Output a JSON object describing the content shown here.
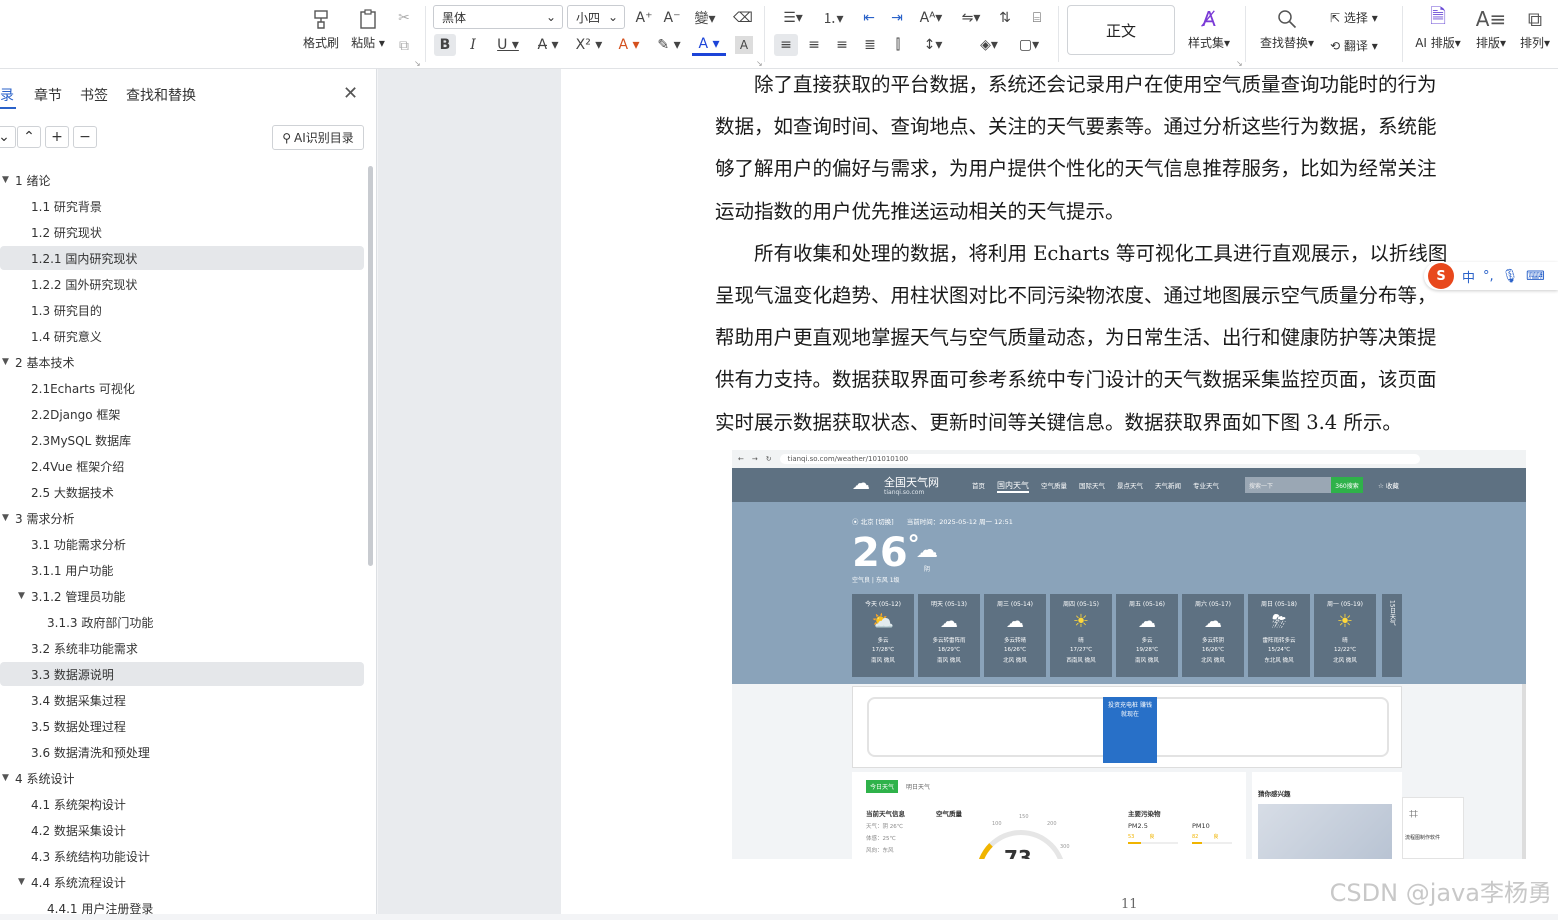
{
  "toolbar": {
    "format_painter": "格式刷",
    "paste": "粘贴",
    "font_name": "黑体",
    "font_size": "小四",
    "style_normal": "正文",
    "style_set": "样式集",
    "find_replace": "查找替换",
    "select": "选择",
    "translate": "翻译",
    "ai_layout": "AI 排版",
    "layout": "排版",
    "arrange": "排列"
  },
  "nav": {
    "tabs": [
      "目录",
      "章节",
      "书签",
      "查找和替换"
    ],
    "ai_button": "AI识别目录",
    "items": [
      {
        "label": "1 绪论",
        "level": 0,
        "expanded": true,
        "selected": false
      },
      {
        "label": "1.1 研究背景",
        "level": 1,
        "selected": false
      },
      {
        "label": "1.2 研究现状",
        "level": 1,
        "selected": false
      },
      {
        "label": "1.2.1 国内研究现状",
        "level": 1,
        "selected": true
      },
      {
        "label": "1.2.2 国外研究现状",
        "level": 1,
        "selected": false
      },
      {
        "label": "1.3 研究目的",
        "level": 1,
        "selected": false
      },
      {
        "label": "1.4 研究意义",
        "level": 1,
        "selected": false
      },
      {
        "label": "2 基本技术",
        "level": 0,
        "expanded": true,
        "selected": false
      },
      {
        "label": "2.1Echarts 可视化",
        "level": 1,
        "selected": false
      },
      {
        "label": "2.2Django  框架",
        "level": 1,
        "selected": false
      },
      {
        "label": "2.3MySQL 数据库",
        "level": 1,
        "selected": false
      },
      {
        "label": "2.4Vue 框架介绍",
        "level": 1,
        "selected": false
      },
      {
        "label": "2.5 大数据技术",
        "level": 1,
        "selected": false
      },
      {
        "label": "3 需求分析",
        "level": 0,
        "expanded": true,
        "selected": false
      },
      {
        "label": "3.1 功能需求分析",
        "level": 1,
        "selected": false
      },
      {
        "label": "3.1.1 用户功能",
        "level": 1,
        "selected": false
      },
      {
        "label": "3.1.2 管理员功能",
        "level": 1,
        "expanded": true,
        "selected": false
      },
      {
        "label": "3.1.3 政府部门功能",
        "level": 2,
        "selected": false
      },
      {
        "label": "3.2 系统非功能需求",
        "level": 1,
        "selected": false
      },
      {
        "label": "3.3 数据源说明",
        "level": 1,
        "selected": true
      },
      {
        "label": "3.4 数据采集过程",
        "level": 1,
        "selected": false
      },
      {
        "label": "3.5 数据处理过程",
        "level": 1,
        "selected": false
      },
      {
        "label": "3.6 数据清洗和预处理",
        "level": 1,
        "selected": false
      },
      {
        "label": "4 系统设计",
        "level": 0,
        "expanded": true,
        "selected": false
      },
      {
        "label": "4.1 系统架构设计",
        "level": 1,
        "selected": false
      },
      {
        "label": "4.2 数据采集设计",
        "level": 1,
        "selected": false
      },
      {
        "label": "4.3 系统结构功能设计",
        "level": 1,
        "selected": false
      },
      {
        "label": "4.4 系统流程设计",
        "level": 1,
        "expanded": true,
        "selected": false
      },
      {
        "label": "4.4.1 用户注册登录",
        "level": 2,
        "selected": false
      }
    ]
  },
  "document": {
    "lines": [
      "　　除了直接获取的平台数据，系统还会记录用户在使用空气质量查询功能时的行为",
      "数据，如查询时间、查询地点、关注的天气要素等。通过分析这些行为数据，系统能",
      "够了解用户的偏好与需求，为用户提供个性化的天气信息推荐服务，比如为经常关注",
      "运动指数的用户优先推送运动相关的天气提示。",
      "　　所有收集和处理的数据，将利用 Echarts 等可视化工具进行直观展示，以折线图",
      "呈现气温变化趋势、用柱状图对比不同污染物浓度、通过地图展示空气质量分布等，",
      "帮助用户更直观地掌握天气与空气质量动态，为日常生活、出行和健康防护等决策提",
      "供有力支持。数据获取界面可参考系统中专门设计的天气数据采集监控页面，该页面",
      "实时展示数据获取状态、更新时间等关键信息。数据获取界面如下图 3.4 所示。"
    ],
    "page_number": "11",
    "watermark": "CSDN @java李杨勇"
  },
  "ime": {
    "lang": "中"
  },
  "screenshot": {
    "url": "tianqi.so.com/weather/101010100",
    "site_name": "全国天气网",
    "site_domain": "tianqi.so.com",
    "nav": [
      "首页",
      "国内天气",
      "空气质量",
      "国际天气",
      "景点天气",
      "天气新闻",
      "专业天气"
    ],
    "search_placeholder": "搜索一下",
    "search_button": "360搜索",
    "favorite": "收藏",
    "location": "北京 [切换]",
    "time": "当前时间：2025-05-12  周一  12:51",
    "temp": "26",
    "degree": "°",
    "cond": "阴",
    "sub": "空气良  |  东风 1级",
    "forecast_more": "15日天气",
    "forecast": [
      {
        "day": "今天 (05-12)",
        "icon": "partly-cloudy",
        "cond": "多云",
        "temp": "17/28℃",
        "wind": "南风 微风"
      },
      {
        "day": "明天 (05-13)",
        "icon": "cloud",
        "cond": "多云转雷阵雨",
        "temp": "18/29℃",
        "wind": "南风 微风"
      },
      {
        "day": "周三 (05-14)",
        "icon": "cloud",
        "cond": "多云转晴",
        "temp": "16/26℃",
        "wind": "北风 微风"
      },
      {
        "day": "周四 (05-15)",
        "icon": "sun",
        "cond": "晴",
        "temp": "17/27℃",
        "wind": "西南风 微风"
      },
      {
        "day": "周五 (05-16)",
        "icon": "cloud",
        "cond": "多云",
        "temp": "19/28℃",
        "wind": "南风 微风"
      },
      {
        "day": "周六 (05-17)",
        "icon": "cloud",
        "cond": "多云转阴",
        "temp": "16/26℃",
        "wind": "北风 微风"
      },
      {
        "day": "周日 (05-18)",
        "icon": "rain",
        "cond": "雷阵雨转多云",
        "temp": "15/24℃",
        "wind": "东北风 微风"
      },
      {
        "day": "周一 (05-19)",
        "icon": "sun",
        "cond": "晴",
        "temp": "12/22℃",
        "wind": "北风 微风"
      }
    ],
    "ad_text": "投资充电桩 赚钱就现在",
    "today_tab": "今日天气",
    "tomorrow_tab": "明日天气",
    "cur_title": "当前天气信息",
    "cur_rows": [
      "天气：阴 26℃",
      "体感：25℃",
      "风向：东风"
    ],
    "aqi_title": "空气质量",
    "aqi_value": "73",
    "aqi_ticks": [
      "50",
      "100",
      "150",
      "200",
      "300"
    ],
    "pollutant_title": "主要污染物",
    "pollutants": [
      {
        "name": "PM2.5",
        "value": "53",
        "level": "良"
      },
      {
        "name": "PM10",
        "value": "82",
        "level": "良"
      }
    ],
    "interest_title": "猜你感兴趣",
    "promo_caption": "流程图制作软件"
  }
}
